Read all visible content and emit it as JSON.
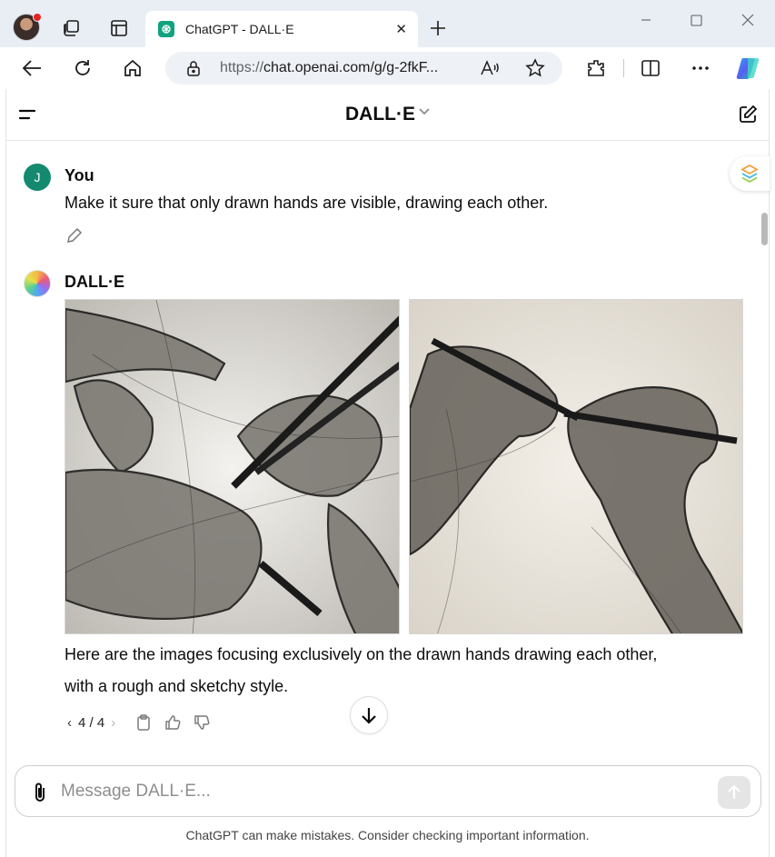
{
  "browser": {
    "tab_title": "ChatGPT - DALL·E",
    "url_prefix": "https://",
    "url_main": "chat.openai.com/g/g-2fkF...",
    "colors": {
      "tabstrip": "#e9eef5",
      "urlbar": "#eef1f5"
    }
  },
  "header": {
    "title": "DALL·E"
  },
  "messages": [
    {
      "author": "You",
      "avatar_letter": "J",
      "text": "Make it sure that only drawn hands are visible, drawing each other."
    },
    {
      "author": "DALL·E",
      "images": [
        "drawn-hands-sketch-1",
        "drawn-hands-sketch-2"
      ],
      "text_line1": "Here are the images focusing exclusively on the drawn hands drawing each other,",
      "text_line2": "with a rough and sketchy style.",
      "pager": "4 / 4"
    }
  ],
  "composer": {
    "placeholder": "Message DALL·E..."
  },
  "disclaimer": "ChatGPT can make mistakes. Consider checking important information.",
  "colors": {
    "user_avatar": "#138a6f",
    "accent": "#10a37f"
  }
}
